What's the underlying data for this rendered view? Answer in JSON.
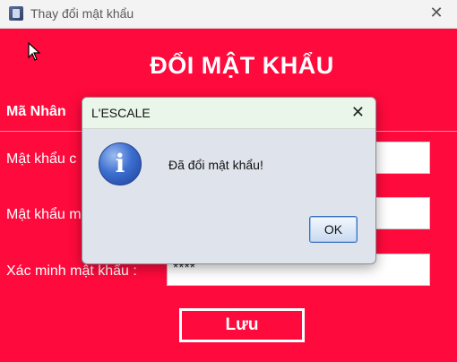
{
  "window": {
    "title": "Thay đổi mật khẩu",
    "close_icon": "close-icon"
  },
  "form": {
    "heading": "ĐỔI MẬT KHẨU",
    "employee_label": "Mã Nhân",
    "old_password_label": "Mật khẩu c",
    "new_password_label": "Mật khẩu m",
    "confirm_label": "Xác minh mật khẩu :",
    "confirm_value": "****",
    "old_password_value": "",
    "new_password_value": "",
    "save_label": "Lưu"
  },
  "dialog": {
    "title": "L'ESCALE",
    "message": "Đã đổi mật khẩu!",
    "ok_label": "OK",
    "icon": "info-icon",
    "icon_glyph": "i"
  }
}
